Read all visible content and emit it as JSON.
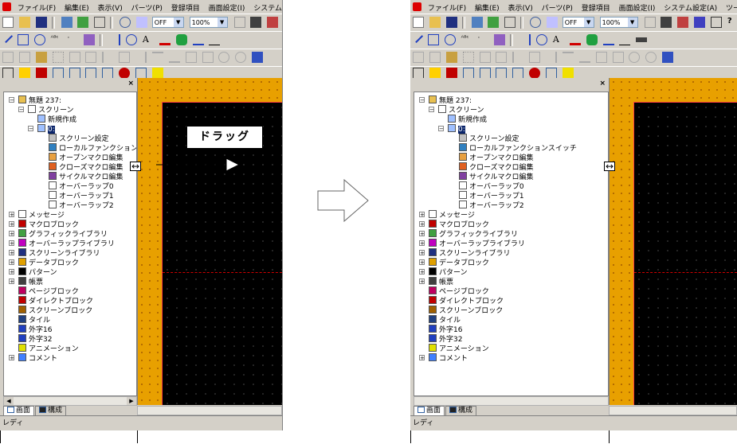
{
  "menu": [
    "ファイル(F)",
    "編集(E)",
    "表示(V)",
    "パーツ(P)",
    "登録項目",
    "画面設定(I)",
    "システム設定(A)",
    "ツール(T)"
  ],
  "toolbar": {
    "off_label": "OFF",
    "zoom": "100%"
  },
  "panel": {
    "close": "×",
    "tree": {
      "root": "無題 237:",
      "screen": "スクリーン",
      "new": "新規作成",
      "node0": "0:",
      "children": [
        "スクリーン設定",
        "ローカルファンクションスイッチ",
        "オープンマクロ編集",
        "クローズマクロ編集",
        "サイクルマクロ編集",
        "オーバーラップ0",
        "オーバーラップ1",
        "オーバーラップ2"
      ],
      "items": [
        "メッセージ",
        "マクロブロック",
        "グラフィックライブラリ",
        "オーバーラップライブラリ",
        "スクリーンライブラリ",
        "データブロック",
        "パターン",
        "帳票",
        "ページブロック",
        "ダイレクトブロック",
        "スクリーンブロック",
        "タイル",
        "外字16",
        "外字32",
        "アニメーション",
        "コメント"
      ]
    },
    "tabs": [
      "画面",
      "構成"
    ]
  },
  "status": "レディ",
  "annotation": {
    "drag": "ドラッグ"
  },
  "icon_colors": {
    "accent": "#d00000",
    "workarea": "#e8a000",
    "selection": "#0a246a"
  }
}
